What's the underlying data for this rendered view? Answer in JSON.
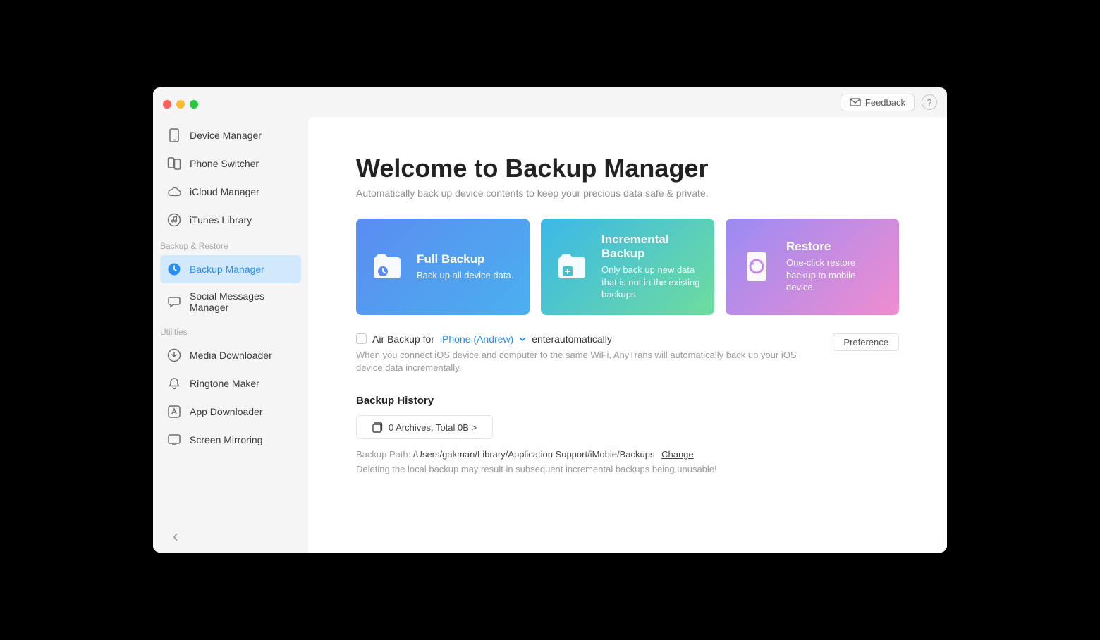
{
  "topbar": {
    "feedback_label": "Feedback",
    "help_label": "?"
  },
  "sidebar": {
    "group_main": [
      {
        "label": "Device Manager"
      },
      {
        "label": "Phone Switcher"
      },
      {
        "label": "iCloud Manager"
      },
      {
        "label": "iTunes Library"
      }
    ],
    "section_backup_label": "Backup & Restore",
    "group_backup": [
      {
        "label": "Backup Manager"
      },
      {
        "label": "Social Messages Manager"
      }
    ],
    "section_utilities_label": "Utilities",
    "group_utilities": [
      {
        "label": "Media Downloader"
      },
      {
        "label": "Ringtone Maker"
      },
      {
        "label": "App Downloader"
      },
      {
        "label": "Screen Mirroring"
      }
    ]
  },
  "page": {
    "title": "Welcome to Backup Manager",
    "subtitle": "Automatically back up device contents to keep your precious data safe & private."
  },
  "cards": {
    "full": {
      "title": "Full Backup",
      "desc": "Back up all device data."
    },
    "incremental": {
      "title": "Incremental Backup",
      "desc": "Only back up new data that is not in the existing backups."
    },
    "restore": {
      "title": "Restore",
      "desc": "One-click restore backup to mobile device."
    }
  },
  "air": {
    "prefix": "Air Backup for",
    "device": "iPhone (Andrew)",
    "suffix": "enterautomatically",
    "desc": "When you connect iOS device and computer to the same WiFi, AnyTrans will automatically back up your iOS device data incrementally.",
    "preference_label": "Preference"
  },
  "history": {
    "title": "Backup History",
    "archive_label": "0 Archives, Total  0B >",
    "path_label": "Backup Path: ",
    "path_value": "/Users/gakman/Library/Application Support/iMobie/Backups",
    "change_label": "Change",
    "warning": "Deleting the local backup may result in subsequent incremental backups being unusable!"
  }
}
